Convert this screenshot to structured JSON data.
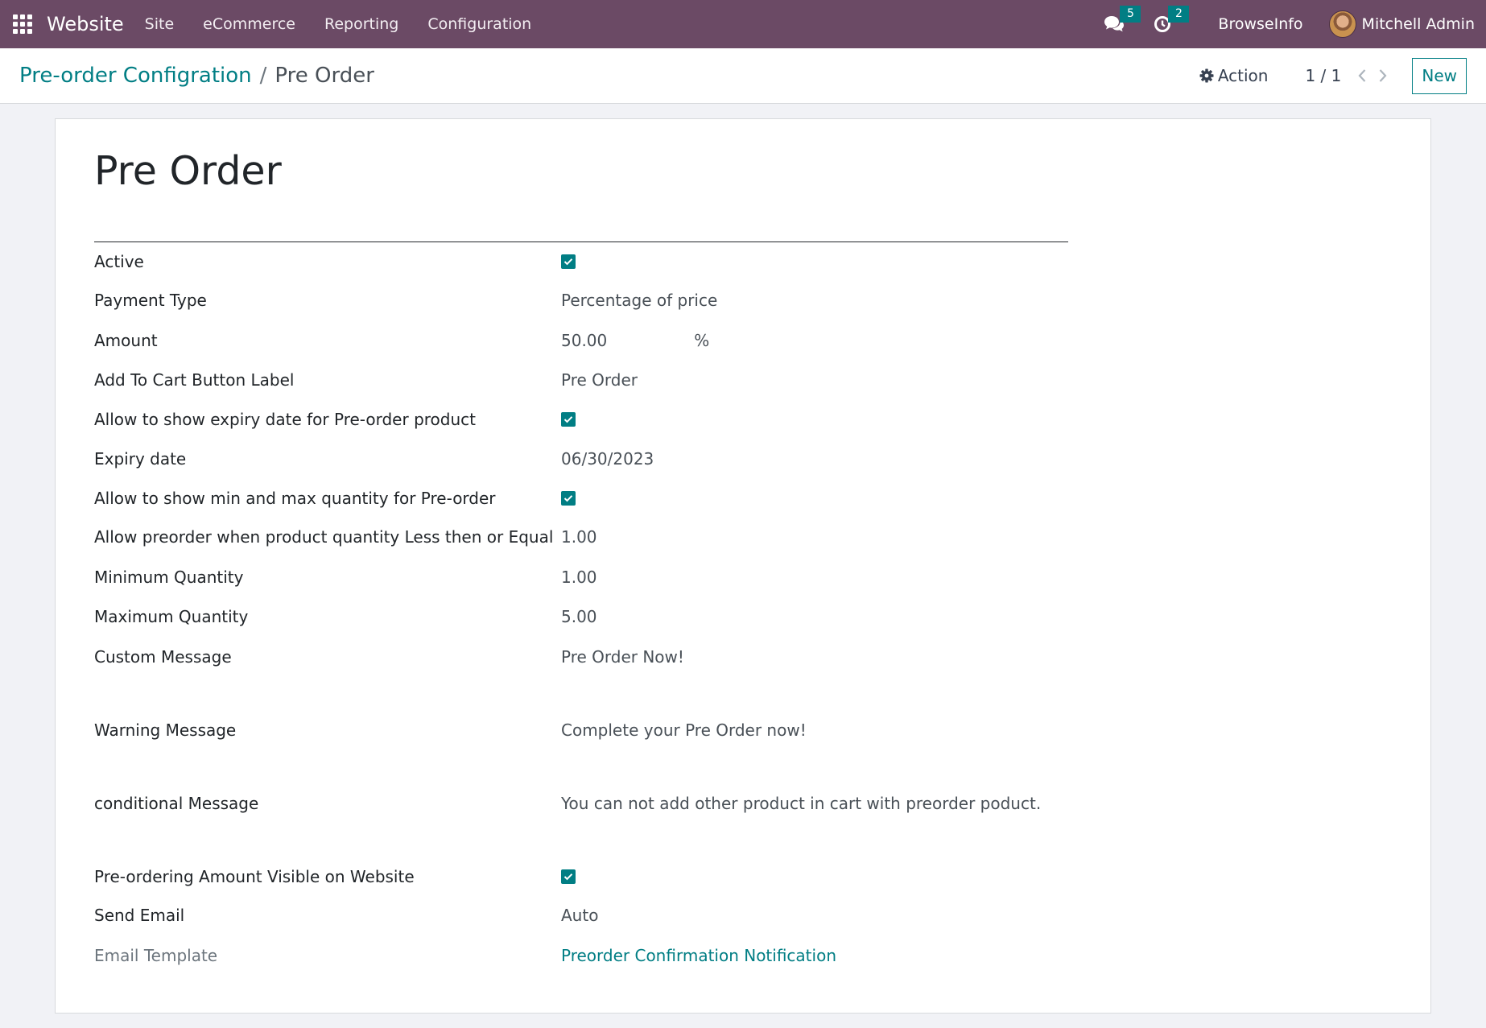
{
  "navbar": {
    "app_title": "Website",
    "menu": [
      "Site",
      "eCommerce",
      "Reporting",
      "Configuration"
    ],
    "messages_count": "5",
    "activities_count": "2",
    "company": "BrowseInfo",
    "user": "Mitchell Admin",
    "bg_color": "#6b4a65"
  },
  "control_panel": {
    "breadcrumb_parent": "Pre-order Configration",
    "breadcrumb_sep": "/",
    "breadcrumb_current": "Pre Order",
    "action_label": "Action",
    "pager": "1 / 1",
    "new_label": "New"
  },
  "form": {
    "title": "Pre Order",
    "fields": {
      "active": {
        "label": "Active",
        "checked": true
      },
      "payment_type": {
        "label": "Payment Type",
        "value": "Percentage of price"
      },
      "amount": {
        "label": "Amount",
        "value": "50.00",
        "unit": "%"
      },
      "cart_label": {
        "label": "Add To Cart Button Label",
        "value": "Pre Order"
      },
      "show_expiry": {
        "label": "Allow to show expiry date for Pre-order product",
        "checked": true
      },
      "expiry_date": {
        "label": "Expiry date",
        "value": "06/30/2023"
      },
      "show_minmax": {
        "label": "Allow to show min and max quantity for Pre-order",
        "checked": true
      },
      "allow_qty": {
        "label": "Allow preorder when product quantity Less then or Equal",
        "value": "1.00"
      },
      "min_qty": {
        "label": "Minimum Quantity",
        "value": "1.00"
      },
      "max_qty": {
        "label": "Maximum Quantity",
        "value": "5.00"
      },
      "custom_msg": {
        "label": "Custom Message",
        "value": "Pre Order Now!"
      },
      "warning_msg": {
        "label": "Warning Message",
        "value": "Complete your Pre Order now!"
      },
      "conditional_msg": {
        "label": "conditional Message",
        "value": "You can not add other product in cart with preorder poduct."
      },
      "amount_visible": {
        "label": "Pre-ordering Amount Visible on Website",
        "checked": true
      },
      "send_email": {
        "label": "Send Email",
        "value": "Auto"
      },
      "email_template": {
        "label": "Email Template",
        "value": "Preorder Confirmation Notification"
      }
    }
  },
  "colors": {
    "accent": "#017e84",
    "navbar": "#6b4a65"
  }
}
